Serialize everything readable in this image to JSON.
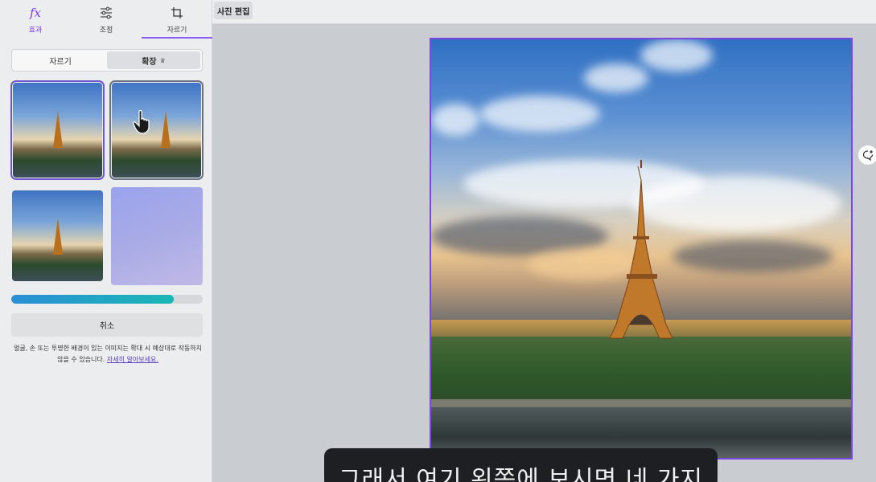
{
  "panel": {
    "tabs": [
      {
        "label": "효과",
        "icon": "fx-icon"
      },
      {
        "label": "조정",
        "icon": "sliders-icon"
      },
      {
        "label": "자르기",
        "icon": "crop-icon"
      }
    ],
    "segment": {
      "crop_label": "자르기",
      "expand_label": "확장",
      "expand_badge_icon": "crown-icon"
    },
    "progress_fraction": 0.85,
    "cancel_label": "취소",
    "note_text": "얼굴, 손 또는 투명한 배경이 있는 이미지는 확대 시 예상대로 작동하지 않을 수 있습니다.",
    "note_link": "자세히 알아보세요."
  },
  "toolbar": {
    "edit_photo_label": "사진 편집"
  },
  "subtitle": {
    "text": "그래서 여기 왼쪽에 보시면 네 가지"
  },
  "colors": {
    "accent": "#7a48e0",
    "progress_start": "#2b8fd6",
    "progress_end": "#19b7b5"
  }
}
